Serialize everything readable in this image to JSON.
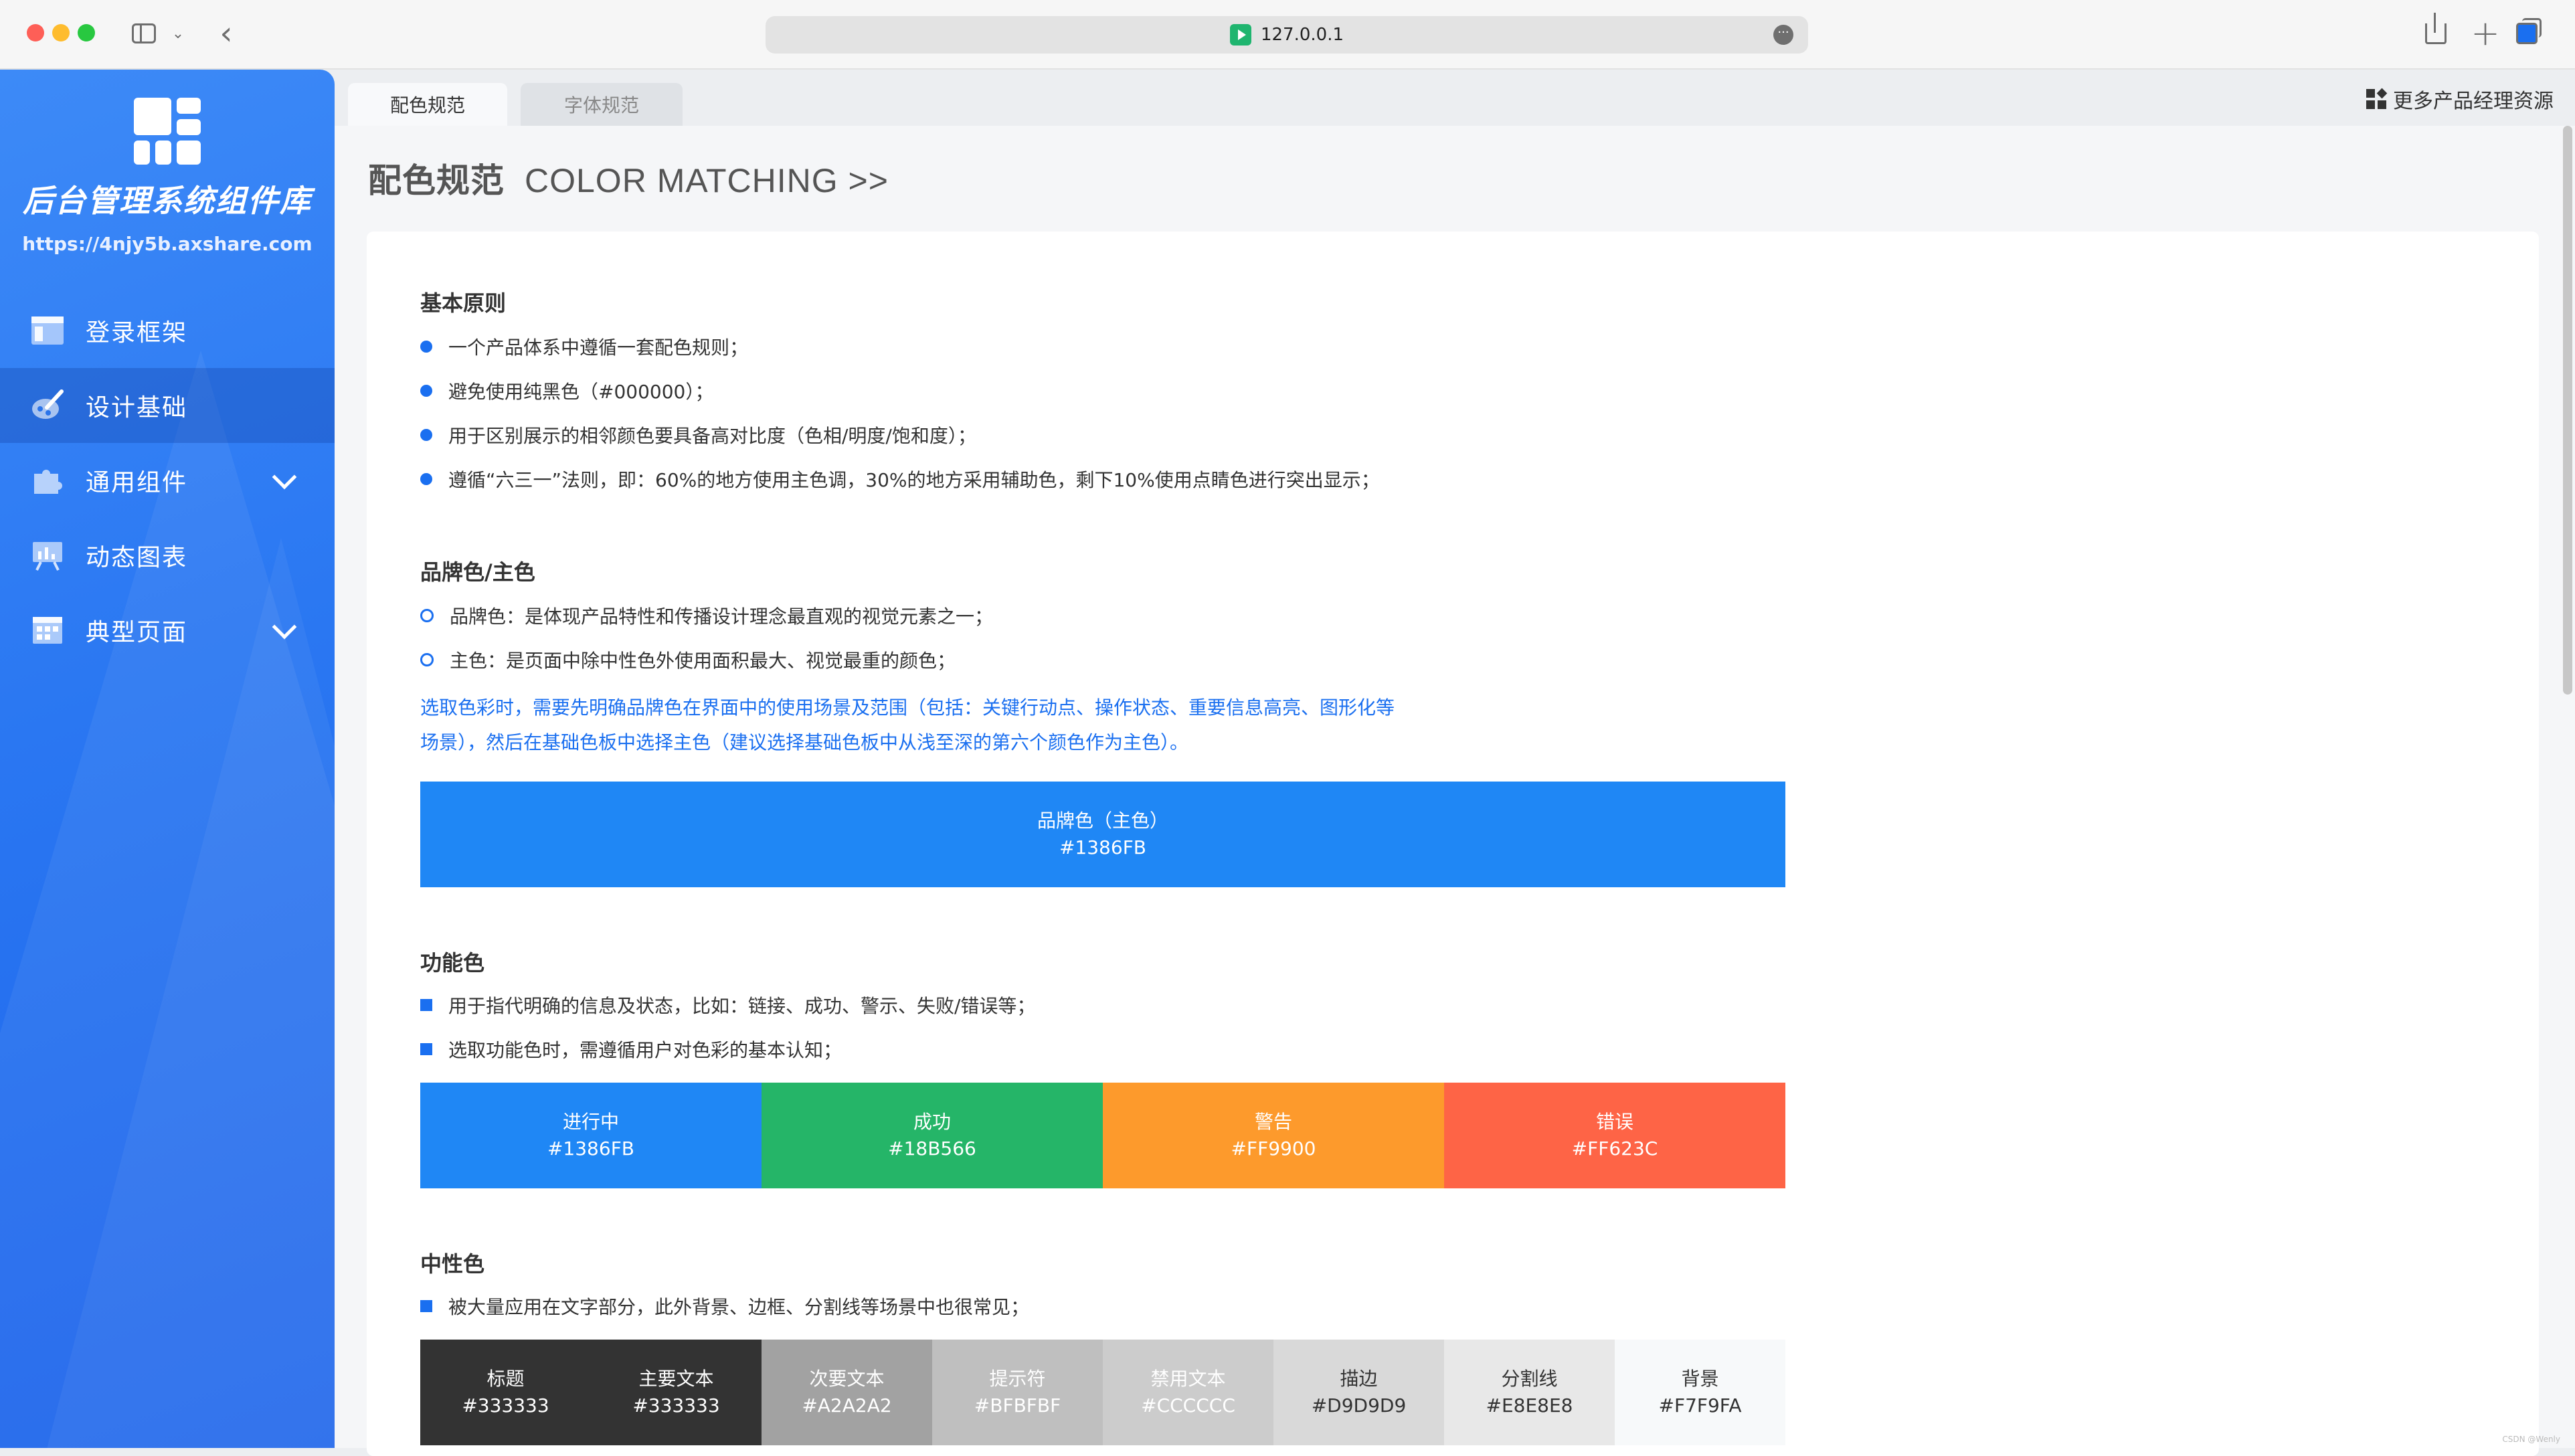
{
  "browser": {
    "url": "127.0.0.1",
    "more_label": "···"
  },
  "sidebar": {
    "title": "后台管理系统组件库",
    "url": "https://4njy5b.axshare.com",
    "items": [
      {
        "label": "登录框架",
        "icon": "window-icon",
        "active": false,
        "expandable": false
      },
      {
        "label": "设计基础",
        "icon": "palette-icon",
        "active": true,
        "expandable": false
      },
      {
        "label": "通用组件",
        "icon": "puzzle-icon",
        "active": false,
        "expandable": true
      },
      {
        "label": "动态图表",
        "icon": "chart-board-icon",
        "active": false,
        "expandable": false
      },
      {
        "label": "典型页面",
        "icon": "layout-icon",
        "active": false,
        "expandable": true
      }
    ]
  },
  "tabs": [
    {
      "label": "配色规范",
      "active": true
    },
    {
      "label": "字体规范",
      "active": false
    }
  ],
  "more_resources": "更多产品经理资源",
  "page": {
    "title_cn": "配色规范",
    "title_en": "COLOR MATCHING >>"
  },
  "basic": {
    "title": "基本原则",
    "items": [
      "一个产品体系中遵循一套配色规则；",
      "避免使用纯黑色（#000000）；",
      "用于区别展示的相邻颜色要具备高对比度（色相/明度/饱和度）；",
      "遵循“六三一”法则，即：60%的地方使用主色调，30%的地方采用辅助色，剩下10%使用点睛色进行突出显示；"
    ]
  },
  "brand": {
    "title": "品牌色/主色",
    "items": [
      "品牌色：是体现产品特性和传播设计理念最直观的视觉元素之一；",
      "主色：是页面中除中性色外使用面积最大、视觉最重的颜色；"
    ],
    "note": "选取色彩时，需要先明确品牌色在界面中的使用场景及范围（包括：关键行动点、操作状态、重要信息高亮、图形化等场景），然后在基础色板中选择主色（建议选择基础色板中从浅至深的第六个颜色作为主色）。",
    "swatch": {
      "name": "品牌色（主色）",
      "hex": "#1386FB",
      "color": "#1f87f5"
    }
  },
  "functional": {
    "title": "功能色",
    "items": [
      "用于指代明确的信息及状态，比如：链接、成功、警示、失败/错误等；",
      "选取功能色时，需遵循用户对色彩的基本认知；"
    ],
    "swatches": [
      {
        "name": "进行中",
        "hex": "#1386FB",
        "color": "#1f87f5",
        "text": "#ffffff"
      },
      {
        "name": "成功",
        "hex": "#18B566",
        "color": "#25b568",
        "text": "#ffffff"
      },
      {
        "name": "警告",
        "hex": "#FF9900",
        "color": "#fd9a2c",
        "text": "#ffffff"
      },
      {
        "name": "错误",
        "hex": "#FF623C",
        "color": "#fe6446",
        "text": "#ffffff"
      }
    ]
  },
  "neutral": {
    "title": "中性色",
    "items": [
      "被大量应用在文字部分，此外背景、边框、分割线等场景中也很常见；"
    ],
    "swatches": [
      {
        "name": "标题",
        "hex": "#333333",
        "color": "#333333",
        "text": "#ffffff"
      },
      {
        "name": "主要文本",
        "hex": "#333333",
        "color": "#333333",
        "text": "#ffffff"
      },
      {
        "name": "次要文本",
        "hex": "#A2A2A2",
        "color": "#a2a2a2",
        "text": "#ffffff"
      },
      {
        "name": "提示符",
        "hex": "#BFBFBF",
        "color": "#bfbfbf",
        "text": "#ffffff"
      },
      {
        "name": "禁用文本",
        "hex": "#CCCCCC",
        "color": "#cccccc",
        "text": "#ffffff"
      },
      {
        "name": "描边",
        "hex": "#D9D9D9",
        "color": "#d9d9d9",
        "text": "#333333"
      },
      {
        "name": "分割线",
        "hex": "#E8E8E8",
        "color": "#e8e8e8",
        "text": "#333333"
      },
      {
        "name": "背景",
        "hex": "#F7F9FA",
        "color": "#f7f9fa",
        "text": "#333333"
      }
    ]
  },
  "watermark": "CSDN @Wenly"
}
